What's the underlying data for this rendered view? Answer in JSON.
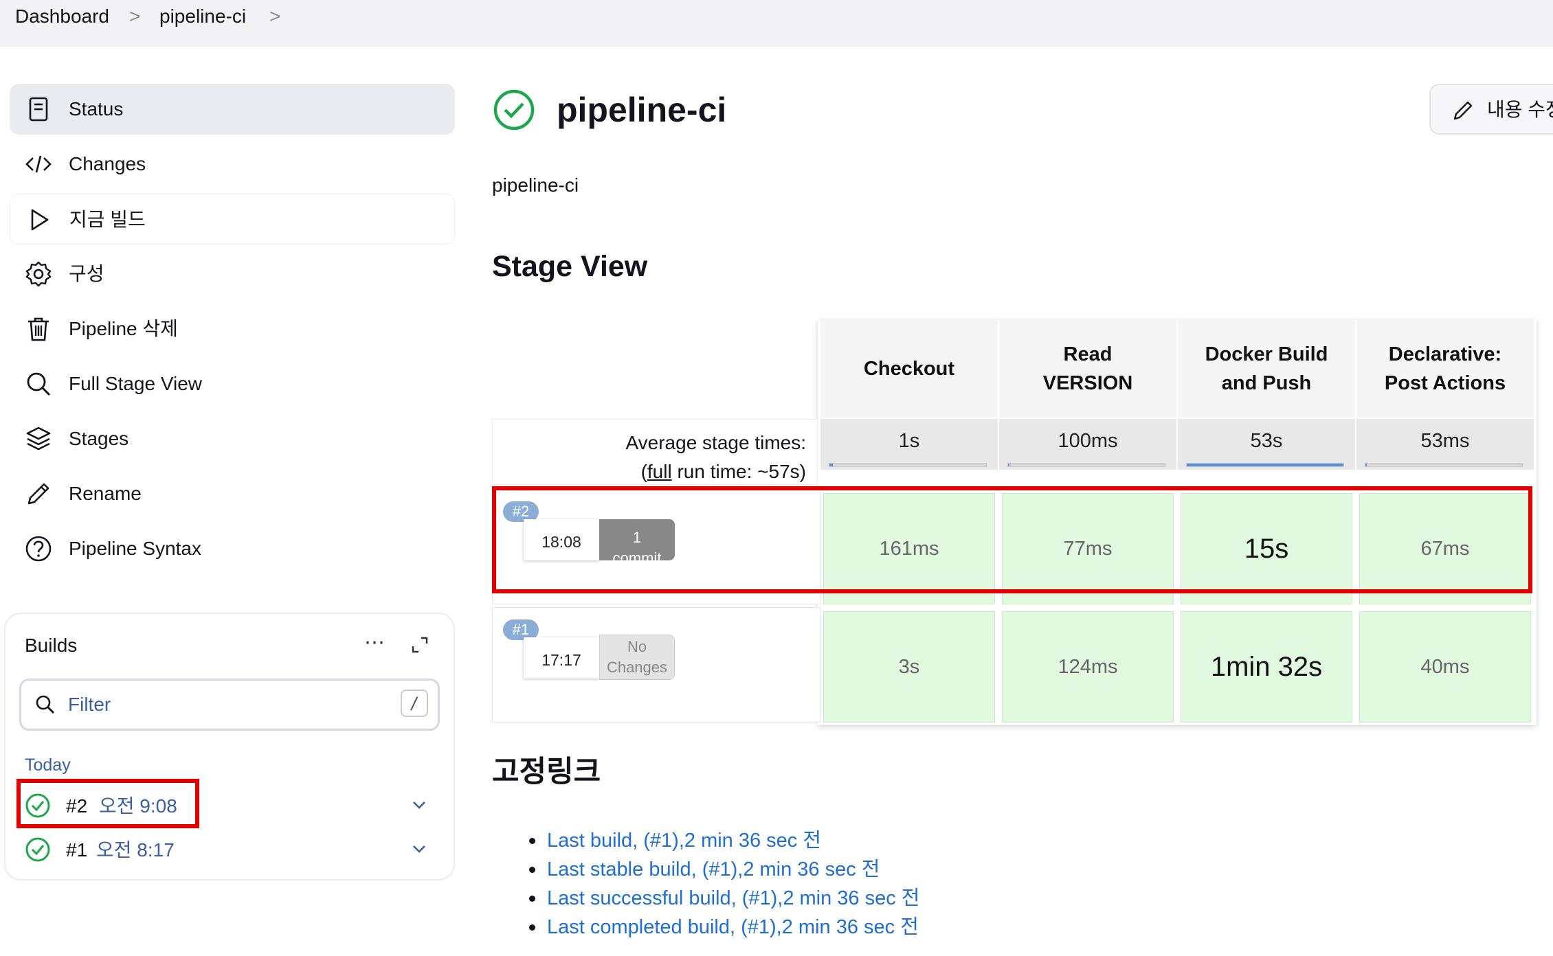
{
  "breadcrumb": {
    "items": [
      "Dashboard",
      "pipeline-ci"
    ],
    "sep": ">"
  },
  "sidebar": {
    "items": [
      {
        "label": "Status",
        "icon": "status-icon"
      },
      {
        "label": "Changes",
        "icon": "code-icon"
      },
      {
        "label": "지금 빌드",
        "icon": "play-icon"
      },
      {
        "label": "구성",
        "icon": "gear-icon"
      },
      {
        "label": "Pipeline 삭제",
        "icon": "trash-icon"
      },
      {
        "label": "Full Stage View",
        "icon": "search-icon"
      },
      {
        "label": "Stages",
        "icon": "layers-icon"
      },
      {
        "label": "Rename",
        "icon": "pencil-icon"
      },
      {
        "label": "Pipeline Syntax",
        "icon": "help-icon"
      }
    ]
  },
  "builds": {
    "title": "Builds",
    "more": "⋯",
    "filter_placeholder": "Filter",
    "filter_shortcut": "/",
    "group": "Today",
    "list": [
      {
        "number": "#2",
        "time": "오전 9:08"
      },
      {
        "number": "#1",
        "time": "오전 8:17"
      }
    ]
  },
  "main": {
    "title": "pipeline-ci",
    "edit_label": "내용 수정",
    "description": "pipeline-ci",
    "stage_view_title": "Stage View",
    "avg_label_1": "Average stage times:",
    "avg_label_2_pre": "(",
    "avg_label_2_link": "full",
    "avg_label_2_post": " run time: ~57s)",
    "stages": [
      {
        "name_line1": "Checkout",
        "name_line2": "",
        "avg": "1s",
        "avg_fraction": 0.02
      },
      {
        "name_line1": "Read",
        "name_line2": "VERSION",
        "avg": "100ms",
        "avg_fraction": 0.01
      },
      {
        "name_line1": "Docker Build",
        "name_line2": "and Push",
        "avg": "53s",
        "avg_fraction": 1.0
      },
      {
        "name_line1": "Declarative:",
        "name_line2": "Post Actions",
        "avg": "53ms",
        "avg_fraction": 0.01
      }
    ],
    "runs": [
      {
        "badge": "#2",
        "time": "18:08",
        "changes_line1": "1",
        "changes_line2": "commit",
        "durations": [
          "161ms",
          "77ms",
          "15s",
          "67ms"
        ]
      },
      {
        "badge": "#1",
        "time": "17:17",
        "changes_line1": "No",
        "changes_line2": "Changes",
        "durations": [
          "3s",
          "124ms",
          "1min 32s",
          "40ms"
        ]
      }
    ],
    "permalinks_title": "고정링크",
    "permalinks": [
      "Last build, (#1),2 min 36 sec 전",
      "Last stable build, (#1),2 min 36 sec 전",
      "Last successful build, (#1),2 min 36 sec 전",
      "Last completed build, (#1),2 min 36 sec 전"
    ]
  },
  "colors": {
    "success": "#1ea64a",
    "highlight": "#e00000",
    "link": "#1f6ed4",
    "stage_cell": "#e0f9df"
  }
}
